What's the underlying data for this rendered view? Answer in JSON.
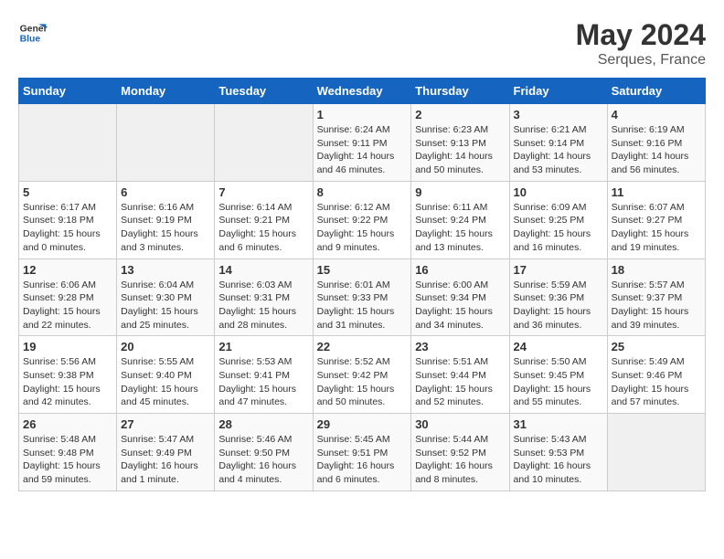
{
  "header": {
    "logo_line1": "General",
    "logo_line2": "Blue",
    "month_year": "May 2024",
    "location": "Serques, France"
  },
  "days_of_week": [
    "Sunday",
    "Monday",
    "Tuesday",
    "Wednesday",
    "Thursday",
    "Friday",
    "Saturday"
  ],
  "weeks": [
    [
      {
        "day": "",
        "info": ""
      },
      {
        "day": "",
        "info": ""
      },
      {
        "day": "",
        "info": ""
      },
      {
        "day": "1",
        "info": "Sunrise: 6:24 AM\nSunset: 9:11 PM\nDaylight: 14 hours\nand 46 minutes."
      },
      {
        "day": "2",
        "info": "Sunrise: 6:23 AM\nSunset: 9:13 PM\nDaylight: 14 hours\nand 50 minutes."
      },
      {
        "day": "3",
        "info": "Sunrise: 6:21 AM\nSunset: 9:14 PM\nDaylight: 14 hours\nand 53 minutes."
      },
      {
        "day": "4",
        "info": "Sunrise: 6:19 AM\nSunset: 9:16 PM\nDaylight: 14 hours\nand 56 minutes."
      }
    ],
    [
      {
        "day": "5",
        "info": "Sunrise: 6:17 AM\nSunset: 9:18 PM\nDaylight: 15 hours\nand 0 minutes."
      },
      {
        "day": "6",
        "info": "Sunrise: 6:16 AM\nSunset: 9:19 PM\nDaylight: 15 hours\nand 3 minutes."
      },
      {
        "day": "7",
        "info": "Sunrise: 6:14 AM\nSunset: 9:21 PM\nDaylight: 15 hours\nand 6 minutes."
      },
      {
        "day": "8",
        "info": "Sunrise: 6:12 AM\nSunset: 9:22 PM\nDaylight: 15 hours\nand 9 minutes."
      },
      {
        "day": "9",
        "info": "Sunrise: 6:11 AM\nSunset: 9:24 PM\nDaylight: 15 hours\nand 13 minutes."
      },
      {
        "day": "10",
        "info": "Sunrise: 6:09 AM\nSunset: 9:25 PM\nDaylight: 15 hours\nand 16 minutes."
      },
      {
        "day": "11",
        "info": "Sunrise: 6:07 AM\nSunset: 9:27 PM\nDaylight: 15 hours\nand 19 minutes."
      }
    ],
    [
      {
        "day": "12",
        "info": "Sunrise: 6:06 AM\nSunset: 9:28 PM\nDaylight: 15 hours\nand 22 minutes."
      },
      {
        "day": "13",
        "info": "Sunrise: 6:04 AM\nSunset: 9:30 PM\nDaylight: 15 hours\nand 25 minutes."
      },
      {
        "day": "14",
        "info": "Sunrise: 6:03 AM\nSunset: 9:31 PM\nDaylight: 15 hours\nand 28 minutes."
      },
      {
        "day": "15",
        "info": "Sunrise: 6:01 AM\nSunset: 9:33 PM\nDaylight: 15 hours\nand 31 minutes."
      },
      {
        "day": "16",
        "info": "Sunrise: 6:00 AM\nSunset: 9:34 PM\nDaylight: 15 hours\nand 34 minutes."
      },
      {
        "day": "17",
        "info": "Sunrise: 5:59 AM\nSunset: 9:36 PM\nDaylight: 15 hours\nand 36 minutes."
      },
      {
        "day": "18",
        "info": "Sunrise: 5:57 AM\nSunset: 9:37 PM\nDaylight: 15 hours\nand 39 minutes."
      }
    ],
    [
      {
        "day": "19",
        "info": "Sunrise: 5:56 AM\nSunset: 9:38 PM\nDaylight: 15 hours\nand 42 minutes."
      },
      {
        "day": "20",
        "info": "Sunrise: 5:55 AM\nSunset: 9:40 PM\nDaylight: 15 hours\nand 45 minutes."
      },
      {
        "day": "21",
        "info": "Sunrise: 5:53 AM\nSunset: 9:41 PM\nDaylight: 15 hours\nand 47 minutes."
      },
      {
        "day": "22",
        "info": "Sunrise: 5:52 AM\nSunset: 9:42 PM\nDaylight: 15 hours\nand 50 minutes."
      },
      {
        "day": "23",
        "info": "Sunrise: 5:51 AM\nSunset: 9:44 PM\nDaylight: 15 hours\nand 52 minutes."
      },
      {
        "day": "24",
        "info": "Sunrise: 5:50 AM\nSunset: 9:45 PM\nDaylight: 15 hours\nand 55 minutes."
      },
      {
        "day": "25",
        "info": "Sunrise: 5:49 AM\nSunset: 9:46 PM\nDaylight: 15 hours\nand 57 minutes."
      }
    ],
    [
      {
        "day": "26",
        "info": "Sunrise: 5:48 AM\nSunset: 9:48 PM\nDaylight: 15 hours\nand 59 minutes."
      },
      {
        "day": "27",
        "info": "Sunrise: 5:47 AM\nSunset: 9:49 PM\nDaylight: 16 hours\nand 1 minute."
      },
      {
        "day": "28",
        "info": "Sunrise: 5:46 AM\nSunset: 9:50 PM\nDaylight: 16 hours\nand 4 minutes."
      },
      {
        "day": "29",
        "info": "Sunrise: 5:45 AM\nSunset: 9:51 PM\nDaylight: 16 hours\nand 6 minutes."
      },
      {
        "day": "30",
        "info": "Sunrise: 5:44 AM\nSunset: 9:52 PM\nDaylight: 16 hours\nand 8 minutes."
      },
      {
        "day": "31",
        "info": "Sunrise: 5:43 AM\nSunset: 9:53 PM\nDaylight: 16 hours\nand 10 minutes."
      },
      {
        "day": "",
        "info": ""
      }
    ]
  ]
}
